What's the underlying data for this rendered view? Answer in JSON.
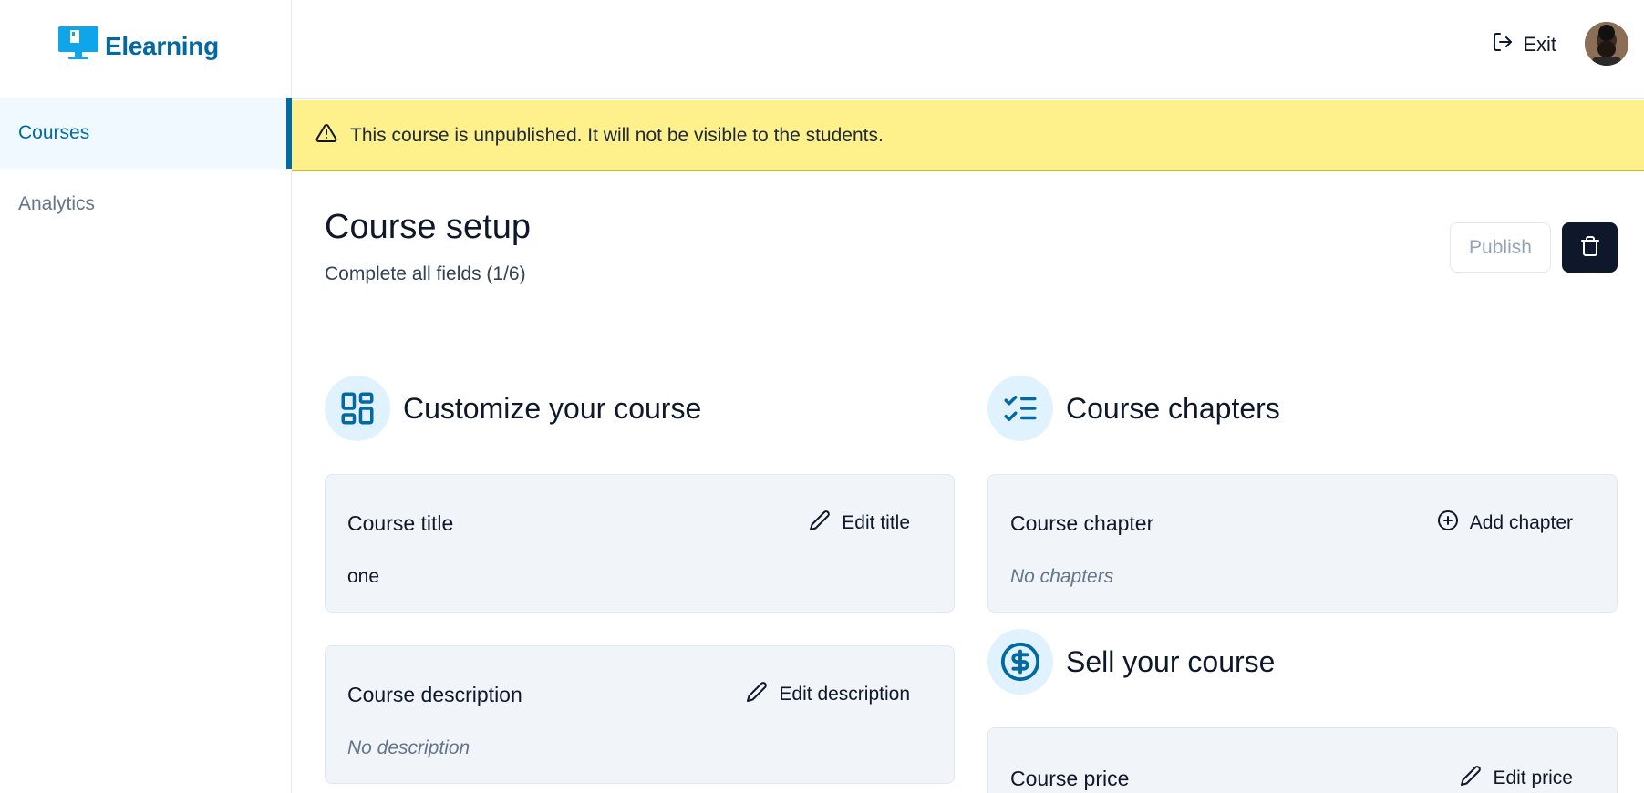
{
  "app": {
    "name": "Elearning"
  },
  "sidebar": {
    "items": [
      {
        "label": "Courses",
        "active": true
      },
      {
        "label": "Analytics",
        "active": false
      }
    ]
  },
  "topbar": {
    "exit_label": "Exit"
  },
  "banner": {
    "text": "This course is unpublished. It will not be visible to the students."
  },
  "page": {
    "title": "Course setup",
    "subtitle": "Complete all fields (1/6)",
    "publish_label": "Publish"
  },
  "sections": {
    "customize": {
      "title": "Customize your course"
    },
    "chapters": {
      "title": "Course chapters"
    },
    "sell": {
      "title": "Sell your course"
    }
  },
  "cards": {
    "title": {
      "label": "Course title",
      "action": "Edit title",
      "value": "one"
    },
    "description": {
      "label": "Course description",
      "action": "Edit description",
      "value": "No description"
    },
    "chapter": {
      "label": "Course chapter",
      "action": "Add chapter",
      "value": "No chapters"
    },
    "price": {
      "label": "Course price",
      "action": "Edit price"
    }
  },
  "colors": {
    "accent": "#0369a1",
    "banner": "#fef08a",
    "dark": "#0f172a",
    "icon_bg": "#e0f2fe"
  }
}
